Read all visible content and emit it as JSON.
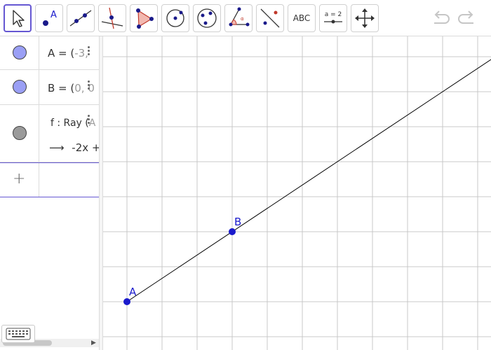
{
  "toolbar": {
    "tools": [
      {
        "name": "move-tool",
        "selected": true
      },
      {
        "name": "point-tool",
        "label": "A"
      },
      {
        "name": "line-tool"
      },
      {
        "name": "perpendicular-line-tool"
      },
      {
        "name": "polygon-tool"
      },
      {
        "name": "circle-center-point-tool"
      },
      {
        "name": "circle-three-points-tool"
      },
      {
        "name": "angle-tool"
      },
      {
        "name": "reflect-tool"
      },
      {
        "name": "text-tool",
        "label": "ABC"
      },
      {
        "name": "slider-tool",
        "label": "a = 2"
      },
      {
        "name": "move-graphics-view-tool"
      }
    ],
    "undo_icon": "undo-icon",
    "redo_icon": "redo-icon"
  },
  "algebra": {
    "items": [
      {
        "id": "A",
        "prefix": "A = (",
        "value": "-3, ",
        "marble_color": "#9a9ff5"
      },
      {
        "id": "B",
        "prefix": "B = (",
        "value": "0, 0",
        "marble_color": "#9a9ff5"
      },
      {
        "id": "f",
        "prefix": "f : Ray (",
        "value": "A",
        "sub_arrow": "⟶",
        "sub_text": "-2x +",
        "marble_color": "#9a9a9a"
      }
    ],
    "add_label": "+"
  },
  "graphics": {
    "points": [
      {
        "name": "A",
        "label": "A"
      },
      {
        "name": "B",
        "label": "B"
      }
    ],
    "point_color": "#1a1acc",
    "line_color": "#000000",
    "grid_color": "#c8c8c8"
  },
  "colors": {
    "accent": "#6557d2",
    "border": "#dadada"
  }
}
